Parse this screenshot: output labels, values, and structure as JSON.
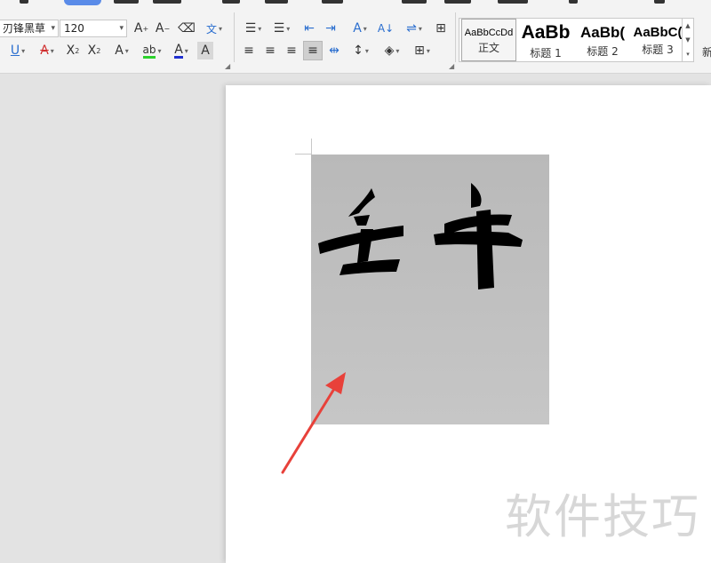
{
  "toolbar": {
    "font_name": "刃锋黑草",
    "font_size": "120",
    "icons": [
      "dropdown-arrow",
      "grow-font-icon",
      "shrink-font-icon",
      "clear-format-icon",
      "pinyin-guide-icon",
      "bullet-list-icon",
      "numbered-list-icon",
      "decrease-indent-icon",
      "increase-indent-icon",
      "text-direction-icon",
      "sort-icon",
      "line-spacing-icon",
      "table-icon",
      "underline-icon",
      "strikethrough-icon",
      "superscript-icon",
      "subscript-icon",
      "text-effect-icon",
      "highlight-icon",
      "font-color-icon",
      "char-shading-icon",
      "align-left-icon",
      "align-center-icon",
      "align-right-icon",
      "justify-icon",
      "distributed-icon",
      "paragraph-spacing-icon",
      "shading-icon",
      "border-icon"
    ]
  },
  "styles": {
    "items": [
      {
        "sample": "AaBbCcDd",
        "name": "正文"
      },
      {
        "sample": "AaBb",
        "name": "标题 1"
      },
      {
        "sample": "AaBb(",
        "name": "标题 2"
      },
      {
        "sample": "AaBbC(",
        "name": "标题 3"
      }
    ],
    "next_hint": "新"
  },
  "document": {
    "image_text": "壬午",
    "watermark": "软件技巧"
  },
  "colors": {
    "accent": "#5a8be8",
    "arrow": "#e8413a",
    "image_bg": "#c3c3c3"
  }
}
